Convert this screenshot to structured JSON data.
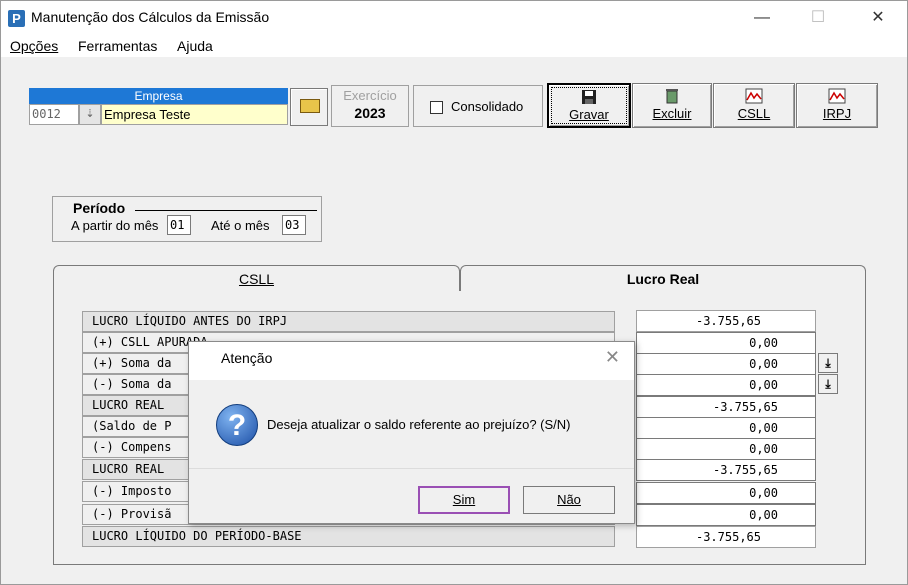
{
  "window": {
    "title": "Manutenção dos Cálculos da Emissão",
    "app_icon_letter": "P",
    "minimize": "—",
    "maximize": "☐",
    "close": "✕"
  },
  "menu": [
    {
      "label": "Opções"
    },
    {
      "label": "Ferramentas"
    },
    {
      "label": "Ajuda"
    }
  ],
  "empresa": {
    "header": "Empresa",
    "code": "0012",
    "name": "Empresa Teste"
  },
  "exercicio": {
    "label": "Exercício",
    "value": "2023"
  },
  "consolidado": {
    "label": "Consolidado",
    "checked": false
  },
  "toolbar": {
    "gravar": "Gravar",
    "excluir": "Excluir",
    "csll": "CSLL",
    "irpj": "IRPJ"
  },
  "periodo": {
    "title": "Período",
    "from_label": "A partir do mês",
    "from_value": "01",
    "to_label": "Até o mês",
    "to_value": "03"
  },
  "tabs": {
    "csll": "CSLL",
    "lucro_real": "Lucro Real"
  },
  "rows": [
    {
      "label": "LUCRO LÍQUIDO ANTES DO IRPJ",
      "value": "-3.755,65"
    },
    {
      "label": "(+) CSLL APURADA",
      "value": "0,00"
    },
    {
      "label": "(+) Soma da",
      "value": "0,00"
    },
    {
      "label": "(-) Soma da",
      "value": "0,00"
    },
    {
      "label": "LUCRO REAL",
      "value": "-3.755,65"
    },
    {
      "label": "(Saldo de P",
      "value": "0,00"
    },
    {
      "label": "(-) Compens",
      "value": "0,00"
    },
    {
      "label": "LUCRO REAL",
      "value": "-3.755,65"
    },
    {
      "label": "(-) Imposto",
      "value": "0,00"
    },
    {
      "label": "(-) Provisã",
      "value": "0,00"
    },
    {
      "label": "LUCRO LÍQUIDO DO PERÍODO-BASE",
      "value": "-3.755,65"
    }
  ],
  "dialog": {
    "title": "Atenção",
    "close": "✕",
    "message": "Deseja atualizar o saldo referente ao prejuízo? (S/N)",
    "yes": "Sim",
    "no": "Não"
  }
}
